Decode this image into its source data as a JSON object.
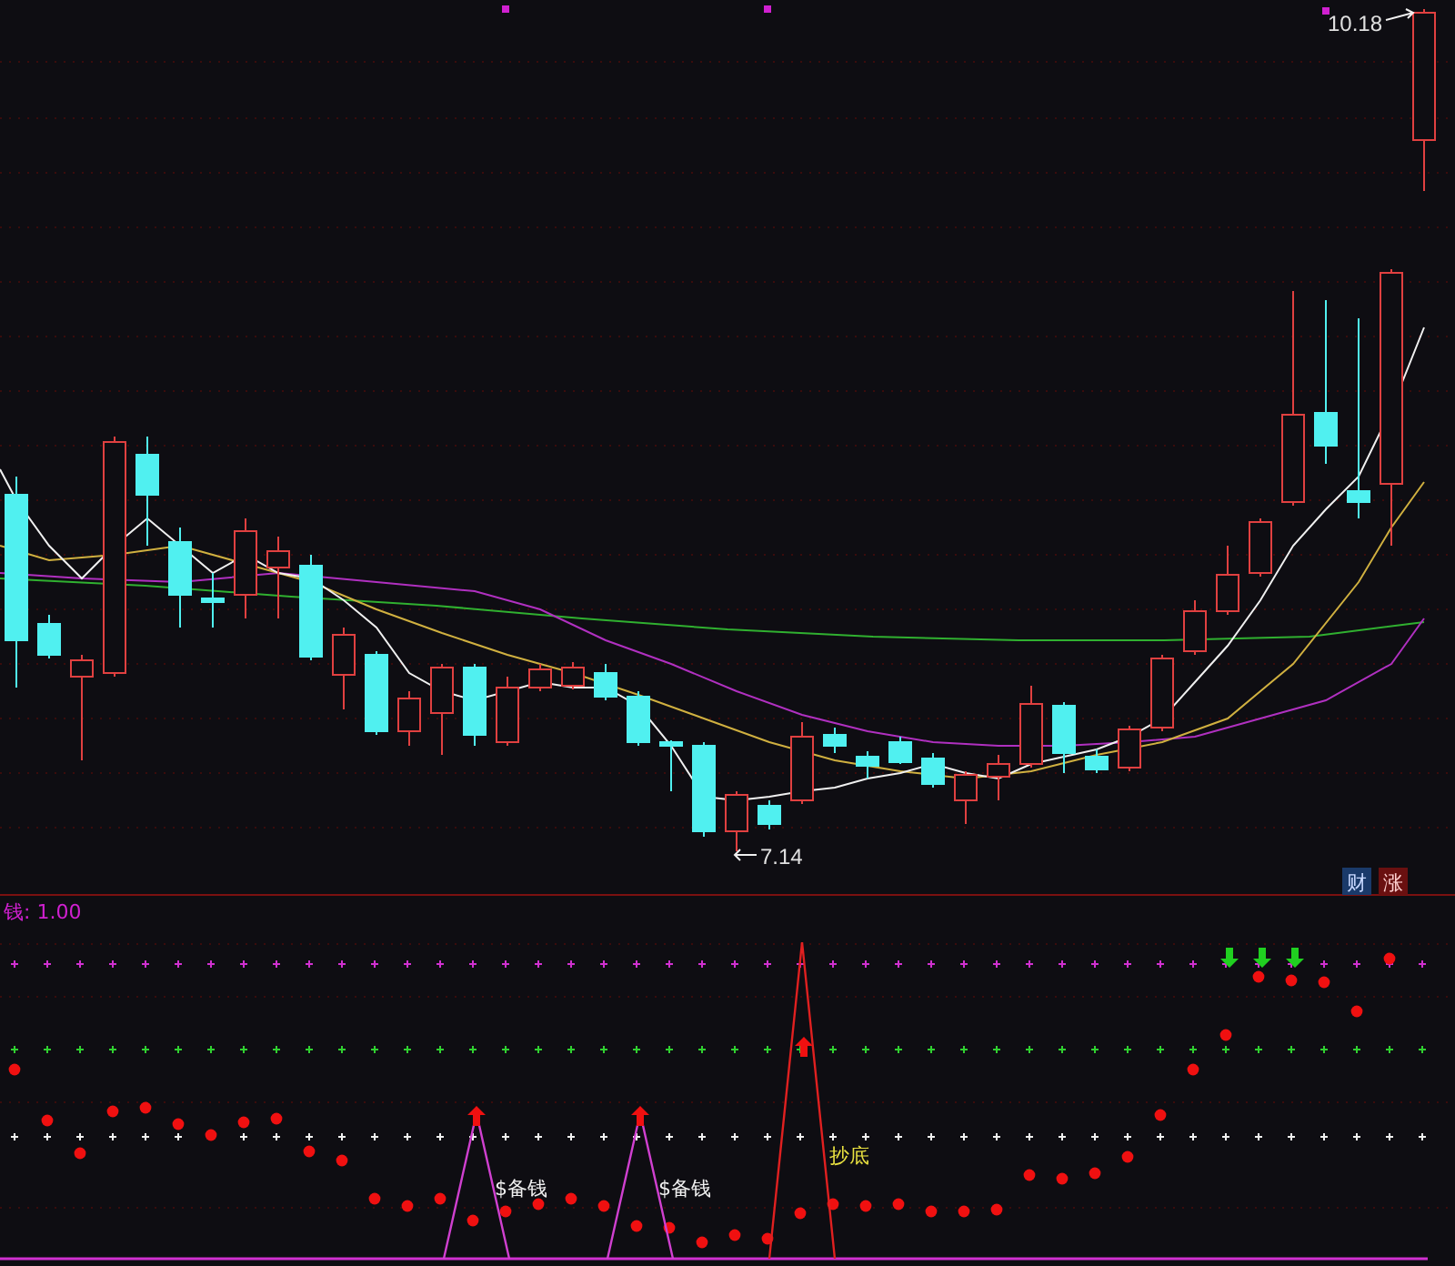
{
  "price_chart": {
    "high_label": "10.18",
    "low_label": "7.14",
    "badges": [
      {
        "text": "财",
        "kind": "finance"
      },
      {
        "text": "涨",
        "kind": "rise"
      }
    ]
  },
  "indicator": {
    "title": "钱: 1.00",
    "signals": [
      {
        "text": "$备钱",
        "kind": "cash"
      },
      {
        "text": "$备钱",
        "kind": "cash"
      },
      {
        "text": "抄底",
        "kind": "bottom"
      }
    ]
  }
}
